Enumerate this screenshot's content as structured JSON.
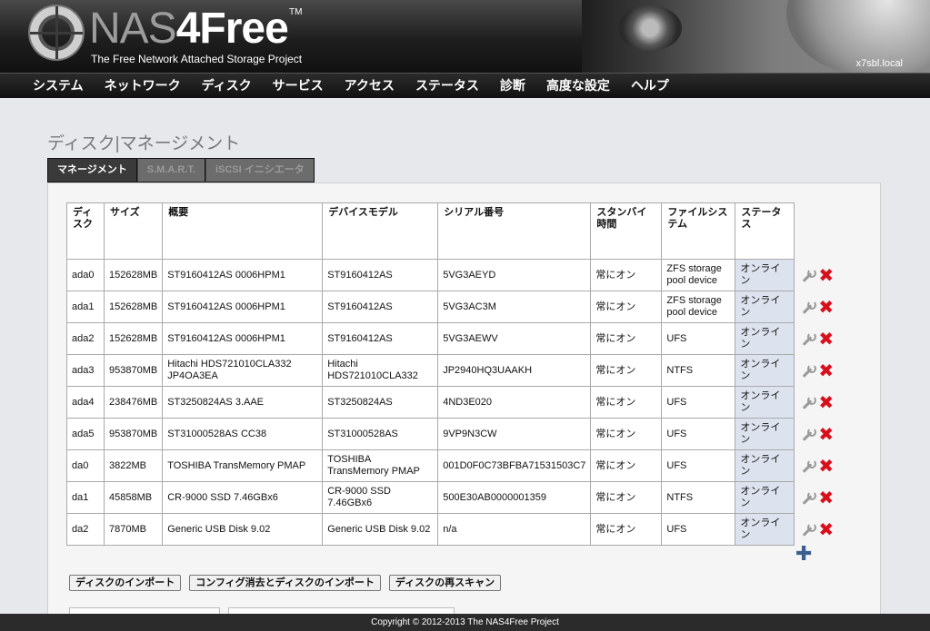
{
  "header": {
    "logo_nas": "NAS",
    "logo_free": "4Free",
    "logo_tm": "TM",
    "tagline": "The Free Network Attached Storage Project",
    "hostname": "x7sbl.local"
  },
  "nav": {
    "items": [
      {
        "label": "システム"
      },
      {
        "label": "ネットワーク"
      },
      {
        "label": "ディスク"
      },
      {
        "label": "サービス"
      },
      {
        "label": "アクセス"
      },
      {
        "label": "ステータス"
      },
      {
        "label": "診断"
      },
      {
        "label": "高度な設定"
      },
      {
        "label": "ヘルプ"
      }
    ]
  },
  "page_title": "ディスク|マネージメント",
  "tabs": [
    {
      "label": "マネージメント",
      "active": true
    },
    {
      "label": "S.M.A.R.T.",
      "active": false
    },
    {
      "label": "iSCSI イニシエータ",
      "active": false
    }
  ],
  "table": {
    "headers": {
      "disk": "ディスク",
      "size": "サイズ",
      "description": "概要",
      "model": "デバイスモデル",
      "serial": "シリアル番号",
      "standby": "スタンバイ時間",
      "filesystem": "ファイルシステム",
      "status": "ステータス"
    },
    "rows": [
      {
        "disk": "ada0",
        "size": "152628MB",
        "description": "ST9160412AS 0006HPM1",
        "model": "ST9160412AS",
        "serial": "5VG3AEYD",
        "standby": "常にオン",
        "filesystem": "ZFS storage pool device",
        "status": "オンライン"
      },
      {
        "disk": "ada1",
        "size": "152628MB",
        "description": "ST9160412AS 0006HPM1",
        "model": "ST9160412AS",
        "serial": "5VG3AC3M",
        "standby": "常にオン",
        "filesystem": "ZFS storage pool device",
        "status": "オンライン"
      },
      {
        "disk": "ada2",
        "size": "152628MB",
        "description": "ST9160412AS 0006HPM1",
        "model": "ST9160412AS",
        "serial": "5VG3AEWV",
        "standby": "常にオン",
        "filesystem": "UFS",
        "status": "オンライン"
      },
      {
        "disk": "ada3",
        "size": "953870MB",
        "description": "Hitachi HDS721010CLA332 JP4OA3EA",
        "model": "Hitachi HDS721010CLA332",
        "serial": "JP2940HQ3UAAKH",
        "standby": "常にオン",
        "filesystem": "NTFS",
        "status": "オンライン"
      },
      {
        "disk": "ada4",
        "size": "238476MB",
        "description": "ST3250824AS 3.AAE",
        "model": "ST3250824AS",
        "serial": "4ND3E020",
        "standby": "常にオン",
        "filesystem": "UFS",
        "status": "オンライン"
      },
      {
        "disk": "ada5",
        "size": "953870MB",
        "description": "ST31000528AS CC38",
        "model": "ST31000528AS",
        "serial": "9VP9N3CW",
        "standby": "常にオン",
        "filesystem": "UFS",
        "status": "オンライン"
      },
      {
        "disk": "da0",
        "size": "3822MB",
        "description": "TOSHIBA TransMemory PMAP",
        "model": "TOSHIBA TransMemory PMAP",
        "serial": "001D0F0C73BFBA71531503C7",
        "standby": "常にオン",
        "filesystem": "UFS",
        "status": "オンライン"
      },
      {
        "disk": "da1",
        "size": "45858MB",
        "description": "CR-9000 SSD 7.46GBx6",
        "model": "CR-9000 SSD 7.46GBx6",
        "serial": "500E30AB0000001359",
        "standby": "常にオン",
        "filesystem": "NTFS",
        "status": "オンライン"
      },
      {
        "disk": "da2",
        "size": "7870MB",
        "description": "Generic USB Disk 9.02",
        "model": "Generic USB Disk 9.02",
        "serial": "n/a",
        "standby": "常にオン",
        "filesystem": "UFS",
        "status": "オンライン"
      }
    ]
  },
  "buttons": {
    "import": "ディスクのインポート",
    "clear_import": "コンフィグ消去とディスクのインポート",
    "rescan": "ディスクの再スキャン"
  },
  "icons": {
    "edit": "wrench-icon",
    "delete": "delete-icon",
    "add": "add-icon"
  },
  "footer": {
    "copyright": "Copyright © 2012-2013 The NAS4Free Project"
  }
}
